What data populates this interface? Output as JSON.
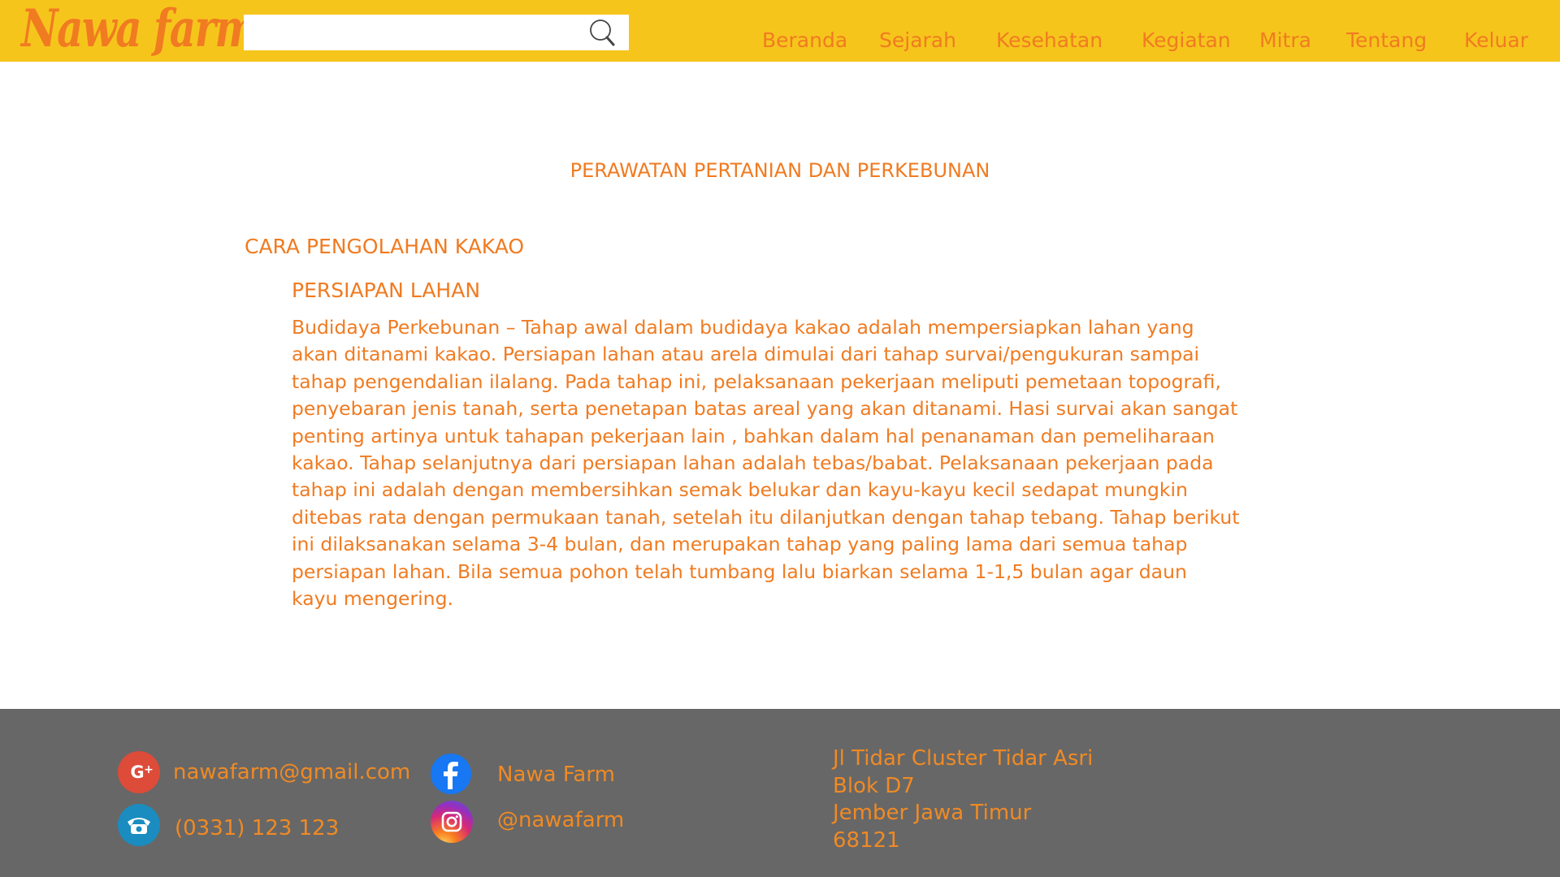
{
  "header": {
    "logo": "Nawa farm",
    "search": {
      "value": "",
      "placeholder": ""
    },
    "nav": [
      {
        "label": "Beranda"
      },
      {
        "label": "Sejarah"
      },
      {
        "label": "Kesehatan"
      },
      {
        "label": "Kegiatan"
      },
      {
        "label": "Mitra"
      },
      {
        "label": "Tentang"
      },
      {
        "label": "Keluar"
      }
    ]
  },
  "main": {
    "page_title": "PERAWATAN PERTANIAN DAN PERKEBUNAN",
    "section_title": "CARA PENGOLAHAN KAKAO",
    "sub_title": "PERSIAPAN LAHAN",
    "paragraph": "Budidaya Perkebunan – Tahap awal dalam budidaya kakao adalah mempersiapkan lahan yang\nakan ditanami kakao. Persiapan lahan atau arela dimulai dari tahap survai/pengukuran sampai\ntahap pengendalian ilalang. Pada tahap ini, pelaksanaan pekerjaan meliputi pemetaan topografi,\npenyebaran jenis tanah, serta penetapan batas areal yang akan ditanami. Hasi survai akan sangat\npenting artinya untuk tahapan pekerjaan lain , bahkan dalam hal penanaman dan pemeliharaan\nkakao. Tahap selanjutnya dari persiapan lahan adalah tebas/babat. Pelaksanaan pekerjaan pada\ntahap ini adalah dengan membersihkan semak belukar dan kayu-kayu kecil sedapat mungkin\nditebas rata dengan permukaan tanah, setelah itu dilanjutkan dengan tahap tebang. Tahap berikut\n ini dilaksanakan selama 3-4 bulan, dan merupakan tahap yang paling lama dari semua tahap\npersiapan lahan. Bila semua pohon telah tumbang lalu biarkan selama 1-1,5 bulan agar daun\nkayu mengering."
  },
  "footer": {
    "email": "nawafarm@gmail.com",
    "phone": "(0331) 123 123",
    "facebook": "Nawa Farm",
    "instagram": "@nawafarm",
    "address": [
      "Jl Tidar Cluster Tidar Asri",
      "Blok D7",
      "Jember Jawa Timur",
      "68121"
    ]
  },
  "colors": {
    "header_bg": "#f6c51c",
    "accent_orange": "#f07b21",
    "footer_bg": "#676767",
    "google_plus": "#dd4b39",
    "phone_icon": "#1a8cc0",
    "facebook": "#1877f2"
  },
  "icons": {
    "search": "search-icon",
    "google_plus": "google-plus-icon",
    "phone": "phone-icon",
    "facebook": "facebook-icon",
    "instagram": "instagram-icon"
  }
}
